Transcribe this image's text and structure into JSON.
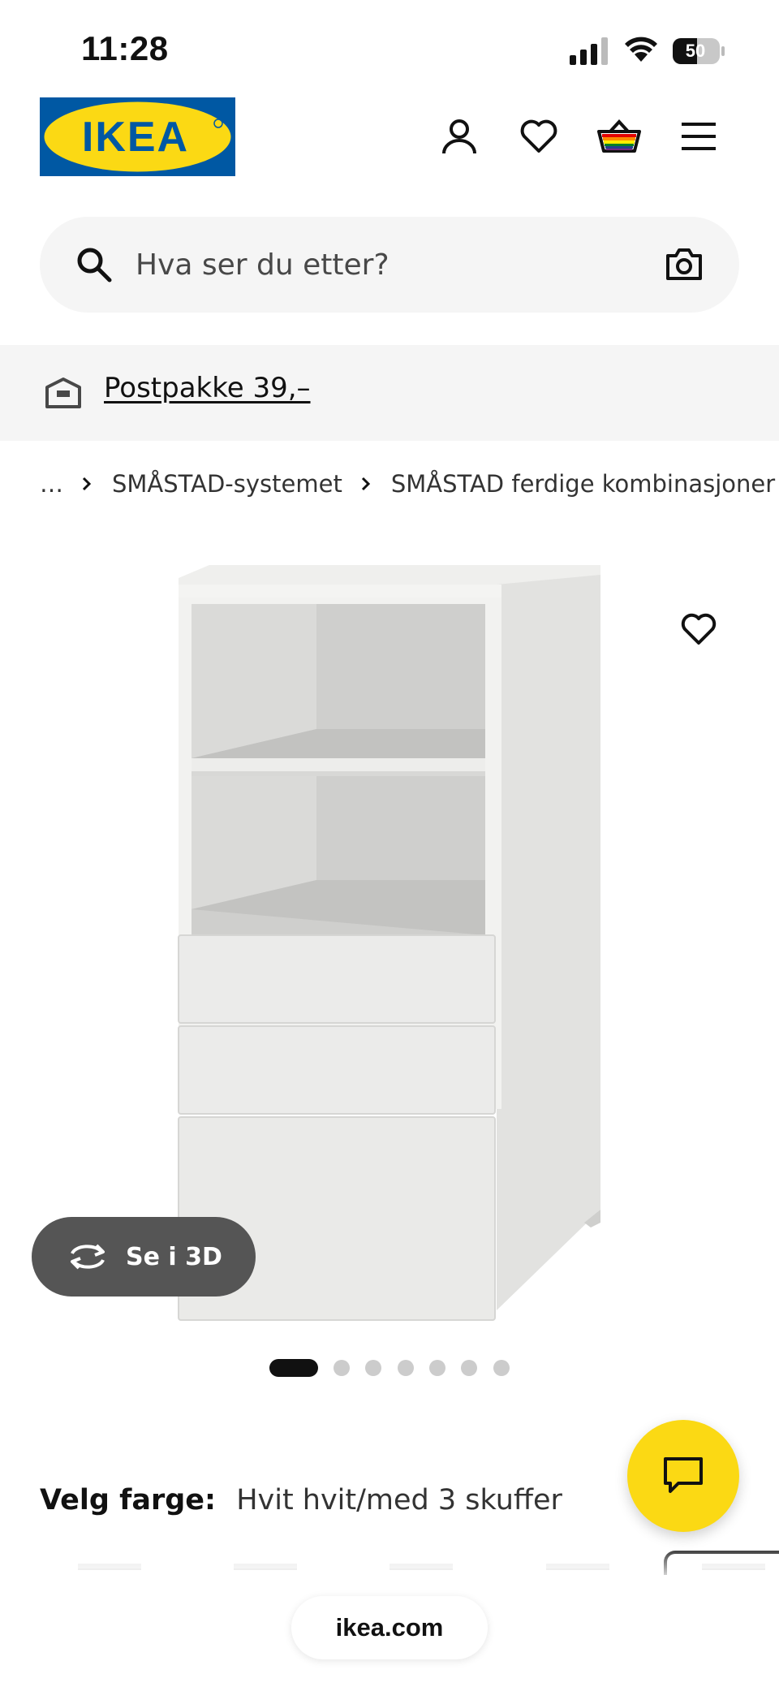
{
  "status_bar": {
    "time": "11:28",
    "battery_level": "50",
    "icons": [
      "signal-icon",
      "wifi-icon",
      "battery-icon"
    ]
  },
  "header": {
    "logo_text": "IKEA",
    "icons": [
      "account-icon",
      "heart-icon",
      "shopping-basket-icon",
      "menu-icon"
    ]
  },
  "search": {
    "placeholder": "Hva ser du etter?",
    "icons": [
      "search-icon",
      "camera-icon"
    ]
  },
  "delivery": {
    "label": "Postpakke 39,–",
    "icon": "delivery-box-icon"
  },
  "breadcrumb": {
    "items": [
      "…",
      "SMÅSTAD-systemet",
      "SMÅSTAD ferdige kombinasjoner"
    ]
  },
  "product": {
    "image_alt": "SMÅSTAD cabinet",
    "view_3d_label": "Se i 3D",
    "carousel": {
      "total": 7,
      "active": 0
    }
  },
  "color_select": {
    "label": "Velg farge:",
    "value": "Hvit hvit/med 3 skuffer"
  },
  "browser": {
    "url": "ikea.com"
  },
  "colors": {
    "ikea_blue": "#0058a3",
    "ikea_yellow": "#fbd914",
    "text_primary": "#111111",
    "surface_grey": "#f5f5f5",
    "pill_dark": "#555555"
  }
}
